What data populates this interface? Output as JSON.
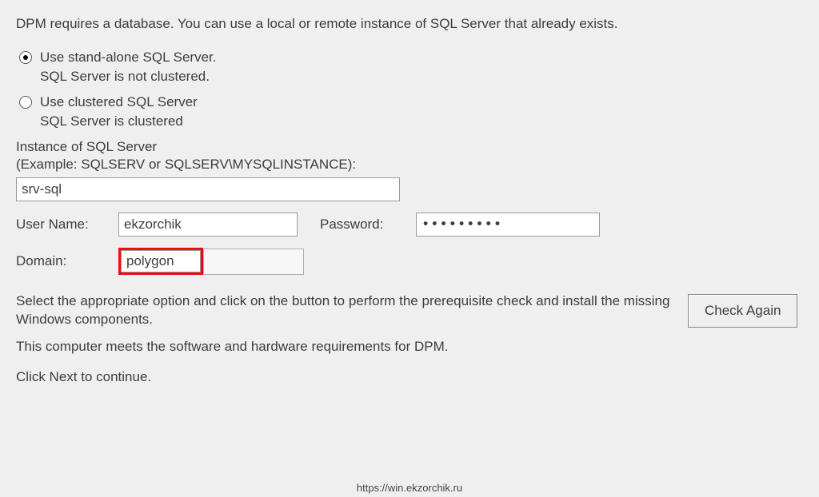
{
  "intro_text": "DPM requires a database. You can use a local or remote instance of SQL Server that already exists.",
  "radio1": {
    "label": "Use stand-alone SQL Server.",
    "sub": "SQL Server is not clustered."
  },
  "radio2": {
    "label": "Use clustered SQL Server",
    "sub": "SQL Server is clustered"
  },
  "instance": {
    "label": "Instance of SQL Server",
    "example": "(Example: SQLSERV or SQLSERV\\MYSQLINSTANCE):",
    "value": "srv-sql"
  },
  "creds": {
    "user_label": "User Name:",
    "user_value": "ekzorchik",
    "pw_label": "Password:",
    "pw_value": "•••••••••",
    "domain_label": "Domain:",
    "domain_value": "polygon"
  },
  "bottom": {
    "prereq_text": "Select the appropriate option and click on the button  to perform the prerequisite check and install the missing Windows components.",
    "check_again_label": "Check Again",
    "meets_text": "This computer meets the software and hardware requirements for DPM.",
    "continue_text": "Click Next to continue."
  },
  "footer_url": "https://win.ekzorchik.ru"
}
